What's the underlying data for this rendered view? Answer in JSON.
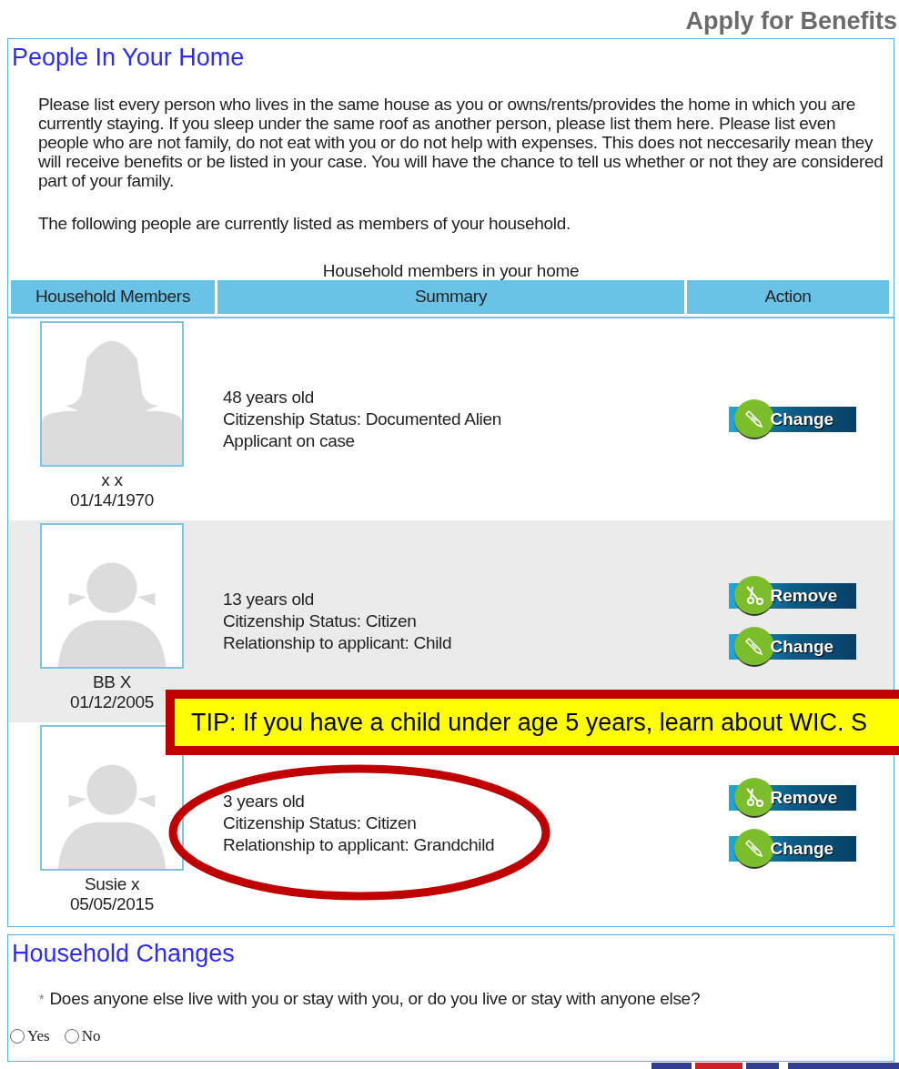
{
  "page_title": "Apply for Benefits",
  "people_section": {
    "title": "People In Your Home",
    "intro": "Please list every person who lives in the same house as you or owns/rents/provides the home in which you are currently staying. If you sleep under the same roof as another person, please list them here. Please list even people who are not family, do not eat with you or do not help with expenses. This does not neccesarily mean they will receive benefits or be listed in your case. You will have the chance to tell us whether or not they are considered part of your family.",
    "listed_note": "The following people are currently listed as members of your household.",
    "table": {
      "caption": "Household members in your home",
      "columns": [
        "Household Members",
        "Summary",
        "Action"
      ],
      "rows": [
        {
          "avatar": {
            "kind": "adult"
          },
          "name": "x x",
          "dob": "01/14/1970",
          "summary": [
            "48 years old",
            "Citizenship Status: Documented Alien",
            "Applicant on case"
          ],
          "actions": [
            {
              "kind": "change",
              "label": "Change"
            }
          ]
        },
        {
          "avatar": {
            "kind": "child"
          },
          "name": "BB X",
          "dob": "01/12/2005",
          "summary": [
            "13 years old",
            "Citizenship Status: Citizen",
            "Relationship to applicant: Child"
          ],
          "actions": [
            {
              "kind": "remove",
              "label": "Remove"
            },
            {
              "kind": "change",
              "label": "Change"
            }
          ]
        },
        {
          "avatar": {
            "kind": "child"
          },
          "name": "Susie x",
          "dob": "05/05/2015",
          "summary": [
            "3 years old",
            "Citizenship Status: Citizen",
            "Relationship to applicant: Grandchild"
          ],
          "actions": [
            {
              "kind": "remove",
              "label": "Remove"
            },
            {
              "kind": "change",
              "label": "Change"
            }
          ]
        }
      ]
    }
  },
  "tip": "TIP: If you have a child under age 5 years, learn about WIC. S",
  "changes_section": {
    "title": "Household Changes",
    "required_mark": "*",
    "question": "Does anyone else live with you or stay with you, or do you live or stay with anyone else?",
    "options": [
      {
        "label": "Yes",
        "selected": false
      },
      {
        "label": "No",
        "selected": false
      }
    ]
  }
}
